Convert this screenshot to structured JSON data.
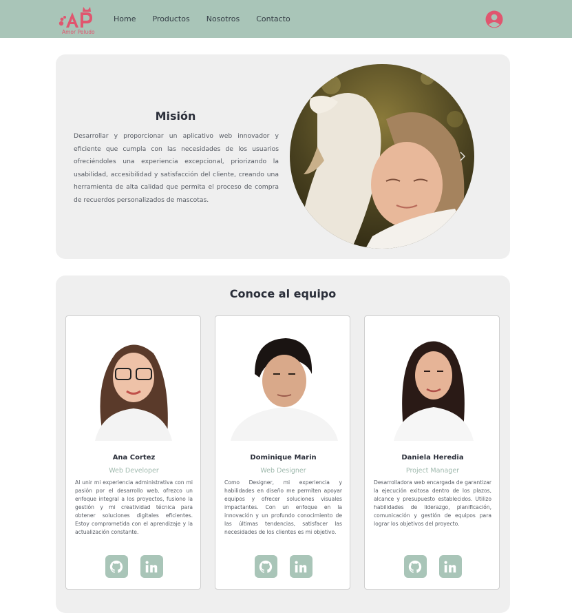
{
  "brand": {
    "name": "Amor Peludo",
    "color": "#e0566f",
    "accent": "#a9c5b8"
  },
  "nav": {
    "links": [
      "Home",
      "Productos",
      "Nosotros",
      "Contacto"
    ],
    "user_icon": "user-circle-icon"
  },
  "mission": {
    "title": "Misión",
    "text": "Desarrollar y proporcionar un aplicativo web innovador y eficiente que cumpla con las necesidades de los usuarios ofreciéndoles una experiencia excepcional, priorizando la usabilidad, accesibilidad y satisfacción del cliente, creando una herramienta de alta calidad que permita el proceso de compra de recuerdos personalizados de mascotas.",
    "next_icon": "chevron-right-icon"
  },
  "team": {
    "title": "Conoce al equipo",
    "members": [
      {
        "name": "Ana Cortez",
        "role": "Web Developer",
        "bio": "Al unir mi experiencia administrativa con mi pasión por el desarrollo web, ofrezco un enfoque integral a los proyectos, fusiono la gestión y mi creatividad técnica para obtener soluciones digitales eficientes. Estoy comprometida con el aprendizaje y la actualización constante."
      },
      {
        "name": "Dominique Marin",
        "role": "Web Designer",
        "bio": "Como Designer, mi experiencia y habilidades en diseño me permiten apoyar equipos y ofrecer soluciones visuales impactantes. Con un enfoque en la innovación y un profundo conocimiento de las últimas tendencias, satisfacer las necesidades de los clientes es mi objetivo."
      },
      {
        "name": "Daniela Heredia",
        "role": "Project Manager",
        "bio": "Desarrolladora web encargada de garantizar la ejecución exitosa dentro de los plazos, alcance y presupuesto establecidos. Utilizo habilidades de liderazgo, planificación, comunicación y gestión de equipos para lograr los objetivos del proyecto."
      }
    ],
    "social_icons": [
      "github-icon",
      "linkedin-icon"
    ]
  }
}
